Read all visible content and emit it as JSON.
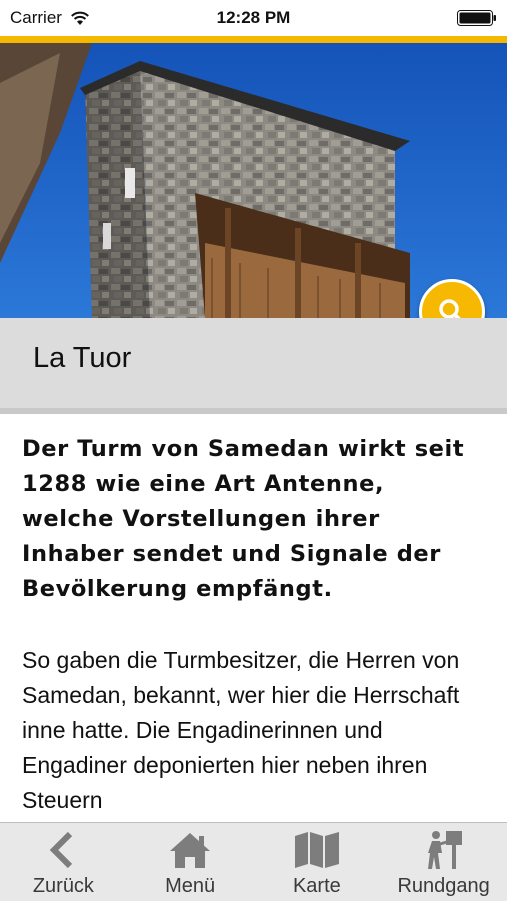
{
  "status_bar": {
    "carrier": "Carrier",
    "time": "12:28 PM"
  },
  "colors": {
    "accent": "#f5b800",
    "title_band": "#dcdcdc",
    "tab_bar": "#e8e8e8",
    "icon_gray": "#7d7d7d"
  },
  "hero": {
    "image": "stone-tower-with-wooden-balcony",
    "search_icon": "search-icon"
  },
  "page": {
    "title": "La Tuor",
    "lead": "Der Turm von Samedan wirkt seit 1288 wie eine Art Antenne, welche Vorstellungen ihrer Inhaber sendet und Signale der Bevölkerung empfängt.",
    "body": "So gaben die Turmbesitzer, die Herren von Samedan, bekannt, wer hier die Herrschaft inne hatte. Die Engadinerinnen und Engadiner deponierten hier neben ihren Steuern"
  },
  "tab_bar": {
    "items": [
      {
        "label": "Zurück",
        "icon": "chevron-left-icon"
      },
      {
        "label": "Menü",
        "icon": "home-icon"
      },
      {
        "label": "Karte",
        "icon": "map-icon"
      },
      {
        "label": "Rundgang",
        "icon": "walking-tour-icon"
      }
    ]
  }
}
